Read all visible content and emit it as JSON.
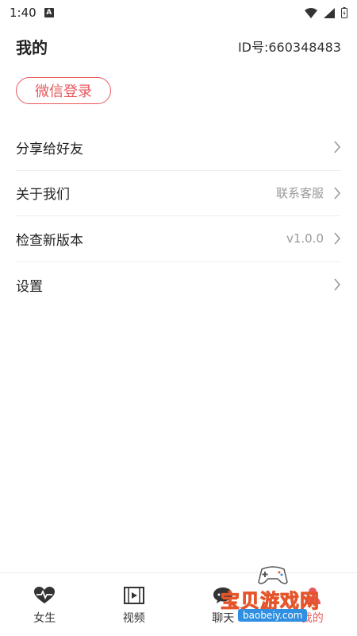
{
  "status_bar": {
    "time": "1:40",
    "notification_letter": "A"
  },
  "header": {
    "title": "我的",
    "user_id": "ID号:660348483"
  },
  "login": {
    "wechat_label": "微信登录"
  },
  "menu": {
    "items": [
      {
        "label": "分享给好友",
        "value": ""
      },
      {
        "label": "关于我们",
        "value": "联系客服"
      },
      {
        "label": "检查新版本",
        "value": "v1.0.0"
      },
      {
        "label": "设置",
        "value": ""
      }
    ]
  },
  "tabbar": {
    "tabs": [
      {
        "label": "女生",
        "icon": "heart-pulse-icon"
      },
      {
        "label": "视频",
        "icon": "film-icon"
      },
      {
        "label": "聊天",
        "icon": "chat-bubble-icon"
      },
      {
        "label": "我的",
        "icon": "person-icon"
      }
    ],
    "active_index": 3
  },
  "watermark": {
    "text": "宝贝游戏网",
    "url": "baobeiy.com"
  },
  "colors": {
    "accent": "#e8595c",
    "text": "#222222",
    "secondary": "#999999",
    "divider": "#eeeeee"
  }
}
